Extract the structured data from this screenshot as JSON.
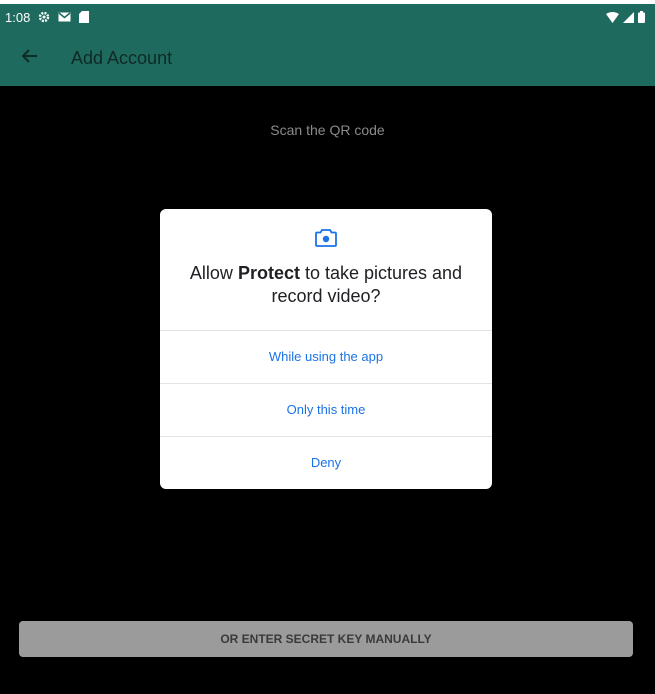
{
  "status_bar": {
    "time": "1:08",
    "icons": [
      "settings-icon",
      "gmail-icon",
      "sd-card-icon",
      "wifi-icon",
      "signal-icon",
      "battery-icon"
    ]
  },
  "app_bar": {
    "back_icon": "arrow-left-icon",
    "title": "Add Account"
  },
  "scanner": {
    "instruction": "Scan the QR code"
  },
  "permission_dialog": {
    "icon": "camera-icon",
    "title_prefix": "Allow ",
    "app_name": "Protect",
    "title_suffix": " to take pictures and record video?",
    "options": [
      {
        "label": "While using the app"
      },
      {
        "label": "Only this time"
      },
      {
        "label": "Deny"
      }
    ]
  },
  "manual_entry": {
    "button_label": "OR ENTER SECRET KEY MANUALLY"
  },
  "colors": {
    "app_bar": "#1e6a5e",
    "accent_blue": "#1a73e8",
    "background": "#000000"
  }
}
